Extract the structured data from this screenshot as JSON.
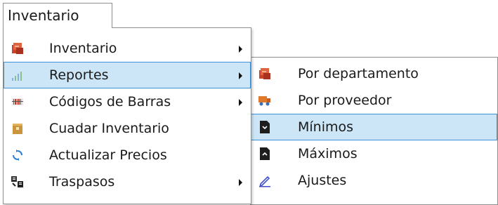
{
  "menubar": {
    "title": "Inventario"
  },
  "menu": {
    "items": [
      {
        "label": "Inventario",
        "icon": "inventory-boxes-icon",
        "has_submenu": true
      },
      {
        "label": "Reportes",
        "icon": "bar-chart-icon",
        "has_submenu": true,
        "highlighted": true
      },
      {
        "label": "Códigos de Barras",
        "icon": "barcode-icon",
        "has_submenu": true
      },
      {
        "label": "Cuadar Inventario",
        "icon": "package-icon",
        "has_submenu": false
      },
      {
        "label": "Actualizar Precios",
        "icon": "refresh-icon",
        "has_submenu": false
      },
      {
        "label": "Traspasos",
        "icon": "transfer-icon",
        "has_submenu": true
      }
    ]
  },
  "submenu": {
    "items": [
      {
        "label": "Por departamento",
        "icon": "report-boxes-icon"
      },
      {
        "label": "Por proveedor",
        "icon": "supplier-truck-icon"
      },
      {
        "label": "Mínimos",
        "icon": "minimum-document-icon",
        "highlighted": true
      },
      {
        "label": "Máximos",
        "icon": "maximum-document-icon"
      },
      {
        "label": "Ajustes",
        "icon": "pencil-edit-icon"
      }
    ]
  },
  "colors": {
    "highlight_bg": "#cde6f7",
    "highlight_border": "#3d8fd6",
    "menu_border": "#8e8e8e"
  }
}
